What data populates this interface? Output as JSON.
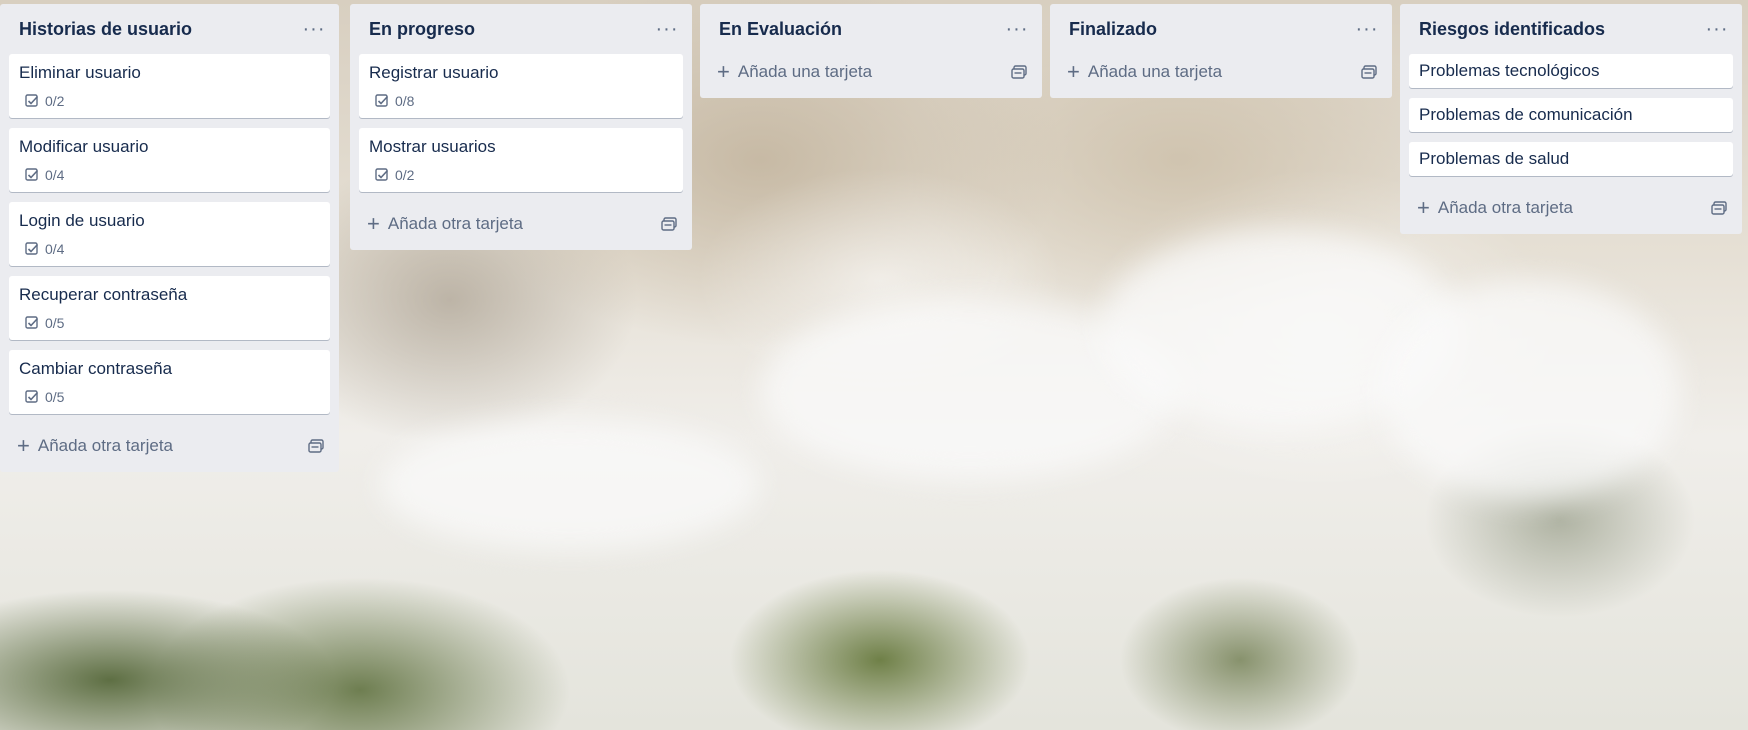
{
  "board": {
    "lists": [
      {
        "title": "Historias de usuario",
        "cards": [
          {
            "title": "Eliminar usuario",
            "checklist": "0/2"
          },
          {
            "title": "Modificar usuario",
            "checklist": "0/4"
          },
          {
            "title": "Login de usuario",
            "checklist": "0/4"
          },
          {
            "title": "Recuperar contraseña",
            "checklist": "0/5"
          },
          {
            "title": "Cambiar contraseña",
            "checklist": "0/5"
          }
        ],
        "add_label": "Añada otra tarjeta"
      },
      {
        "title": "En progreso",
        "cards": [
          {
            "title": "Registrar usuario",
            "checklist": "0/8"
          },
          {
            "title": "Mostrar usuarios",
            "checklist": "0/2"
          }
        ],
        "add_label": "Añada otra tarjeta"
      },
      {
        "title": "En Evaluación",
        "cards": [],
        "add_label": "Añada una tarjeta"
      },
      {
        "title": "Finalizado",
        "cards": [],
        "add_label": "Añada una tarjeta"
      },
      {
        "title": "Riesgos identificados",
        "cards": [
          {
            "title": "Problemas tecnológicos"
          },
          {
            "title": "Problemas de comunicación"
          },
          {
            "title": "Problemas de salud"
          }
        ],
        "add_label": "Añada otra tarjeta"
      }
    ],
    "icons": {
      "menu": "more-horizontal-icon",
      "checklist": "checkbox-icon",
      "add": "plus-icon",
      "template": "card-template-icon"
    }
  }
}
